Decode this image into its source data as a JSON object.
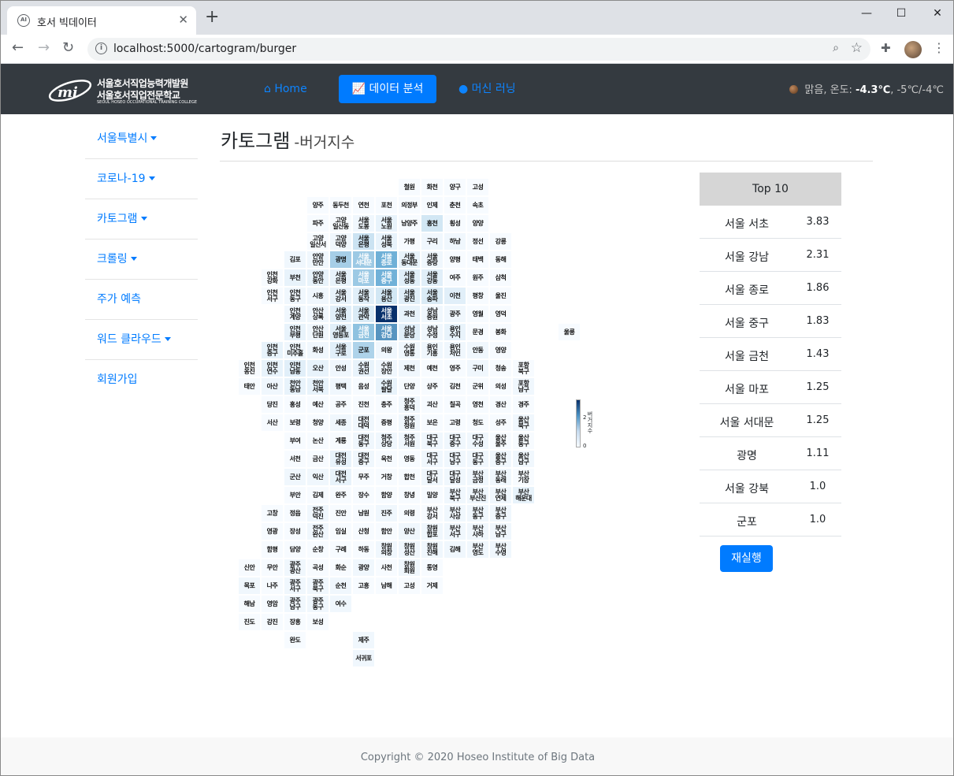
{
  "browser": {
    "tab_title": "호서 빅데이터",
    "url": "localhost:5000/cartogram/burger"
  },
  "site": {
    "logo_line1": "서울호서직업능력개발원",
    "logo_line2": "서울호서직업전문학교",
    "logo_line3": "SEOUL HOSEO OCCUPATIONAL TRAINING COLLEGE",
    "nav": {
      "home": "Home",
      "data": "데이터 분석",
      "ml": "머신 러닝"
    },
    "weather": {
      "prefix": "맑음, 온도: ",
      "temp": "-4.3℃",
      "range": ", -5℃/-4℃"
    }
  },
  "sidebar": [
    "서울특별시",
    "코로나-19",
    "카토그램",
    "크롤링",
    "주가 예측",
    "워드 클라우드",
    "회원가입"
  ],
  "heading": {
    "title": "카토그램",
    "subtitle": "-버거지수"
  },
  "chart_data": {
    "type": "heatmap",
    "title": "카토그램 -버거지수",
    "colorbar": {
      "label": "버거지수",
      "ticks": [
        "2",
        "0"
      ]
    },
    "colors": {
      "low": "#f7fbff",
      "high": "#08306b"
    },
    "cells": [
      [
        "철원",
        7,
        0,
        0
      ],
      [
        "화천",
        8,
        0,
        0
      ],
      [
        "양구",
        9,
        0,
        0
      ],
      [
        "고성",
        10,
        0,
        0
      ],
      [
        "양주",
        3,
        1,
        0
      ],
      [
        "동두천",
        4,
        1,
        0
      ],
      [
        "연천",
        5,
        1,
        0
      ],
      [
        "포천",
        6,
        1,
        0
      ],
      [
        "의정부",
        7,
        1,
        0
      ],
      [
        "인제",
        8,
        1,
        0
      ],
      [
        "춘천",
        9,
        1,
        0
      ],
      [
        "속초",
        10,
        1,
        0
      ],
      [
        "파주",
        3,
        2,
        0
      ],
      [
        "고양\n일산동",
        4,
        2,
        0
      ],
      [
        "서울\n도봉",
        5,
        2,
        0.1
      ],
      [
        "서울\n노원",
        6,
        2,
        0.2
      ],
      [
        "남양주",
        7,
        2,
        0
      ],
      [
        "홍천",
        8,
        2,
        0.5
      ],
      [
        "횡성",
        9,
        2,
        0
      ],
      [
        "양양",
        10,
        2,
        0
      ],
      [
        "고양\n일산서",
        3,
        3,
        0
      ],
      [
        "고양\n덕양",
        4,
        3,
        0.1
      ],
      [
        "서울\n은평",
        5,
        3,
        0.6
      ],
      [
        "서울\n성북",
        6,
        3,
        0.2
      ],
      [
        "가평",
        7,
        3,
        0
      ],
      [
        "구리",
        8,
        3,
        0.1
      ],
      [
        "하남",
        9,
        3,
        0.1
      ],
      [
        "정선",
        10,
        3,
        0
      ],
      [
        "강릉",
        11,
        3,
        0
      ],
      [
        "김포",
        2,
        4,
        0.1
      ],
      [
        "안양\n만안",
        3,
        4,
        0.1
      ],
      [
        "광명",
        4,
        4,
        1.11
      ],
      [
        "서울\n서대문",
        5,
        4,
        1.25
      ],
      [
        "서울\n종로",
        6,
        4,
        1.86
      ],
      [
        "서울\n동대문",
        7,
        4,
        0.2
      ],
      [
        "서울\n중랑",
        8,
        4,
        0.1
      ],
      [
        "양평",
        9,
        4,
        0
      ],
      [
        "태백",
        10,
        4,
        0
      ],
      [
        "동해",
        11,
        4,
        0
      ],
      [
        "인천\n강화",
        1,
        5,
        0
      ],
      [
        "부천",
        2,
        5,
        0.2
      ],
      [
        "안양\n동안",
        3,
        5,
        0.2
      ],
      [
        "서울\n은평",
        4,
        5,
        0.2
      ],
      [
        "서울\n마포",
        5,
        5,
        1.25
      ],
      [
        "서울\n중구",
        6,
        5,
        1.83
      ],
      [
        "서울\n성동",
        7,
        5,
        0.3
      ],
      [
        "서울\n강동",
        8,
        5,
        0.3
      ],
      [
        "여주",
        9,
        5,
        0
      ],
      [
        "원주",
        10,
        5,
        0
      ],
      [
        "삼척",
        11,
        5,
        0
      ],
      [
        "인천\n서구",
        1,
        6,
        0
      ],
      [
        "인천\n동구",
        2,
        6,
        0.1
      ],
      [
        "시흥",
        3,
        6,
        0.1
      ],
      [
        "서울\n강서",
        4,
        6,
        0.2
      ],
      [
        "서울\n동작",
        5,
        6,
        0.3
      ],
      [
        "서울\n용산",
        6,
        6,
        0.5
      ],
      [
        "서울\n광진",
        7,
        6,
        0.3
      ],
      [
        "서울\n송파",
        8,
        6,
        0.4
      ],
      [
        "이천",
        9,
        6,
        0.3
      ],
      [
        "평창",
        10,
        6,
        0
      ],
      [
        "울진",
        11,
        6,
        0
      ],
      [
        "인천\n계양",
        2,
        7,
        0.1
      ],
      [
        "안산\n상록",
        3,
        7,
        0.1
      ],
      [
        "서울\n양천",
        4,
        7,
        0.3
      ],
      [
        "서울\n관악",
        5,
        7,
        0.4
      ],
      [
        "서울\n서초",
        6,
        7,
        3.83
      ],
      [
        "과천",
        7,
        7,
        0.2
      ],
      [
        "성남\n중원",
        8,
        7,
        0.1
      ],
      [
        "광주",
        9,
        7,
        0.1
      ],
      [
        "영월",
        10,
        7,
        0
      ],
      [
        "영덕",
        11,
        7,
        0
      ],
      [
        "인천\n부평",
        2,
        8,
        0.2
      ],
      [
        "안산\n단원",
        3,
        8,
        0.1
      ],
      [
        "서울\n영등포",
        4,
        8,
        0.3
      ],
      [
        "서울\n금천",
        5,
        8,
        1.43
      ],
      [
        "서울\n강남",
        6,
        8,
        2.31
      ],
      [
        "성남\n분당",
        7,
        8,
        0.3
      ],
      [
        "성남\n수정",
        8,
        8,
        0.1
      ],
      [
        "용인\n수지",
        9,
        8,
        0.2
      ],
      [
        "문경",
        10,
        8,
        0
      ],
      [
        "봉화",
        11,
        8,
        0
      ],
      [
        "울릉",
        14,
        8,
        0
      ],
      [
        "인천\n중구",
        1,
        9,
        0.2
      ],
      [
        "인천\n미추홀",
        2,
        9,
        0.1
      ],
      [
        "화성",
        3,
        9,
        0.1
      ],
      [
        "서울\n구로",
        4,
        9,
        0.3
      ],
      [
        "군포",
        5,
        9,
        1.0
      ],
      [
        "의왕",
        6,
        9,
        0.1
      ],
      [
        "수원\n영통",
        7,
        9,
        0.1
      ],
      [
        "용인\n기흥",
        8,
        9,
        0.1
      ],
      [
        "용인\n처인",
        9,
        9,
        0.1
      ],
      [
        "안동",
        10,
        9,
        0.1
      ],
      [
        "영양",
        11,
        9,
        0
      ],
      [
        "인천\n옹진",
        0,
        10,
        0
      ],
      [
        "인천\n연수",
        1,
        10,
        0.2
      ],
      [
        "인천\n남동",
        2,
        10,
        0.3
      ],
      [
        "오산",
        3,
        10,
        0.2
      ],
      [
        "안성",
        4,
        10,
        0.1
      ],
      [
        "수원\n권선",
        5,
        10,
        0.2
      ],
      [
        "수원\n장안",
        6,
        10,
        0.1
      ],
      [
        "제천",
        7,
        10,
        0.1
      ],
      [
        "예천",
        8,
        10,
        0
      ],
      [
        "영주",
        9,
        10,
        0
      ],
      [
        "구미",
        10,
        10,
        0.1
      ],
      [
        "청송",
        11,
        10,
        0
      ],
      [
        "포항\n북구",
        12,
        10,
        0
      ],
      [
        "태안",
        0,
        11,
        0
      ],
      [
        "아산",
        1,
        11,
        0.1
      ],
      [
        "천안\n동남",
        2,
        11,
        0.2
      ],
      [
        "천안\n서북",
        3,
        11,
        0.2
      ],
      [
        "평택",
        4,
        11,
        0.1
      ],
      [
        "음성",
        5,
        11,
        0
      ],
      [
        "수원\n팔달",
        6,
        11,
        0.2
      ],
      [
        "단양",
        7,
        11,
        0
      ],
      [
        "상주",
        8,
        11,
        0
      ],
      [
        "김천",
        9,
        11,
        0
      ],
      [
        "군위",
        10,
        11,
        0
      ],
      [
        "의성",
        11,
        11,
        0
      ],
      [
        "포항\n남구",
        12,
        11,
        0.1
      ],
      [
        "당진",
        1,
        12,
        0
      ],
      [
        "홍성",
        2,
        12,
        0
      ],
      [
        "예산",
        3,
        12,
        0
      ],
      [
        "공주",
        4,
        12,
        0
      ],
      [
        "진천",
        5,
        12,
        0
      ],
      [
        "충주",
        6,
        12,
        0
      ],
      [
        "청주\n흥덕",
        7,
        12,
        0.1
      ],
      [
        "괴산",
        8,
        12,
        0
      ],
      [
        "칠곡",
        9,
        12,
        0
      ],
      [
        "영천",
        10,
        12,
        0
      ],
      [
        "경산",
        11,
        12,
        0
      ],
      [
        "경주",
        12,
        12,
        0
      ],
      [
        "서산",
        1,
        13,
        0
      ],
      [
        "보령",
        2,
        13,
        0
      ],
      [
        "청양",
        3,
        13,
        0
      ],
      [
        "세종",
        4,
        13,
        0.1
      ],
      [
        "대전\n대덕",
        5,
        13,
        0.1
      ],
      [
        "증평",
        6,
        13,
        0
      ],
      [
        "청주\n청원",
        7,
        13,
        0.1
      ],
      [
        "보은",
        8,
        13,
        0
      ],
      [
        "고령",
        9,
        13,
        0
      ],
      [
        "청도",
        10,
        13,
        0
      ],
      [
        "성주",
        11,
        13,
        0
      ],
      [
        "울산\n북구",
        12,
        13,
        0.1
      ],
      [
        "부여",
        2,
        14,
        0
      ],
      [
        "논산",
        3,
        14,
        0
      ],
      [
        "계룡",
        4,
        14,
        0
      ],
      [
        "대전\n동구",
        5,
        14,
        0.1
      ],
      [
        "청주\n상당",
        6,
        14,
        0.1
      ],
      [
        "청주\n서원",
        7,
        14,
        0.1
      ],
      [
        "대구\n북구",
        8,
        14,
        0.1
      ],
      [
        "대구\n중구",
        9,
        14,
        0.1
      ],
      [
        "대구\n수성",
        10,
        14,
        0.1
      ],
      [
        "울산\n울주",
        11,
        14,
        0
      ],
      [
        "울산\n동구",
        12,
        14,
        0
      ],
      [
        "서천",
        2,
        15,
        0
      ],
      [
        "금산",
        3,
        15,
        0
      ],
      [
        "대전\n유성",
        4,
        15,
        0.2
      ],
      [
        "대전\n중구",
        5,
        15,
        0.1
      ],
      [
        "옥천",
        6,
        15,
        0
      ],
      [
        "영동",
        7,
        15,
        0
      ],
      [
        "대구\n서구",
        8,
        15,
        0.1
      ],
      [
        "대구\n남구",
        9,
        15,
        0.1
      ],
      [
        "대구\n동구",
        10,
        15,
        0.1
      ],
      [
        "울산\n중구",
        11,
        15,
        0.1
      ],
      [
        "울산\n남구",
        12,
        15,
        0.1
      ],
      [
        "군산",
        2,
        16,
        0.1
      ],
      [
        "익산",
        3,
        16,
        0.1
      ],
      [
        "대전\n서구",
        4,
        16,
        0.2
      ],
      [
        "무주",
        5,
        16,
        0
      ],
      [
        "거창",
        6,
        16,
        0
      ],
      [
        "합천",
        7,
        16,
        0
      ],
      [
        "대구\n달서",
        8,
        16,
        0.1
      ],
      [
        "대구\n달성",
        9,
        16,
        0.1
      ],
      [
        "부산\n금정",
        10,
        16,
        0.1
      ],
      [
        "부산\n동래",
        11,
        16,
        0.1
      ],
      [
        "부산\n기장",
        12,
        16,
        0
      ],
      [
        "부안",
        2,
        17,
        0
      ],
      [
        "김제",
        3,
        17,
        0
      ],
      [
        "완주",
        4,
        17,
        0
      ],
      [
        "장수",
        5,
        17,
        0
      ],
      [
        "함양",
        6,
        17,
        0
      ],
      [
        "창녕",
        7,
        17,
        0
      ],
      [
        "밀양",
        8,
        17,
        0
      ],
      [
        "부산\n북구",
        9,
        17,
        0.1
      ],
      [
        "부산\n부산진",
        10,
        17,
        0.1
      ],
      [
        "부산\n연제",
        11,
        17,
        0.1
      ],
      [
        "부산\n해운대",
        12,
        17,
        0.2
      ],
      [
        "고창",
        1,
        18,
        0
      ],
      [
        "정읍",
        2,
        18,
        0
      ],
      [
        "전주\n덕진",
        3,
        18,
        0.1
      ],
      [
        "진안",
        4,
        18,
        0
      ],
      [
        "남원",
        5,
        18,
        0
      ],
      [
        "진주",
        6,
        18,
        0.1
      ],
      [
        "의령",
        7,
        18,
        0
      ],
      [
        "부산\n강서",
        8,
        18,
        0
      ],
      [
        "부산\n사상",
        9,
        18,
        0.1
      ],
      [
        "부산\n동구",
        10,
        18,
        0.1
      ],
      [
        "부산\n중구",
        11,
        18,
        0.1
      ],
      [
        "영광",
        1,
        19,
        0
      ],
      [
        "장성",
        2,
        19,
        0
      ],
      [
        "전주\n완산",
        3,
        19,
        0.1
      ],
      [
        "임실",
        4,
        19,
        0
      ],
      [
        "산청",
        5,
        19,
        0
      ],
      [
        "함안",
        6,
        19,
        0
      ],
      [
        "양산",
        7,
        19,
        0.1
      ],
      [
        "창원\n합포",
        8,
        19,
        0.1
      ],
      [
        "부산\n서구",
        9,
        19,
        0.1
      ],
      [
        "부산\n사하",
        10,
        19,
        0.1
      ],
      [
        "부산\n남구",
        11,
        19,
        0.1
      ],
      [
        "함평",
        1,
        20,
        0
      ],
      [
        "담양",
        2,
        20,
        0
      ],
      [
        "순창",
        3,
        20,
        0
      ],
      [
        "구례",
        4,
        20,
        0
      ],
      [
        "하동",
        5,
        20,
        0
      ],
      [
        "창원\n의창",
        6,
        20,
        0.1
      ],
      [
        "창원\n성산",
        7,
        20,
        0.1
      ],
      [
        "창원\n진해",
        8,
        20,
        0.1
      ],
      [
        "김해",
        9,
        20,
        0.1
      ],
      [
        "부산\n영도",
        10,
        20,
        0.1
      ],
      [
        "부산\n수영",
        11,
        20,
        0.1
      ],
      [
        "신안",
        0,
        21,
        0
      ],
      [
        "무안",
        1,
        21,
        0
      ],
      [
        "광주\n광산",
        2,
        21,
        0.1
      ],
      [
        "곡성",
        3,
        21,
        0
      ],
      [
        "화순",
        4,
        21,
        0
      ],
      [
        "광양",
        5,
        21,
        0.1
      ],
      [
        "사천",
        6,
        21,
        0
      ],
      [
        "창원\n회원",
        7,
        21,
        0.1
      ],
      [
        "통영",
        8,
        21,
        0
      ],
      [
        "목포",
        0,
        22,
        0.1
      ],
      [
        "나주",
        1,
        22,
        0
      ],
      [
        "광주\n서구",
        2,
        22,
        0.1
      ],
      [
        "광주\n북구",
        3,
        22,
        0.1
      ],
      [
        "순천",
        4,
        22,
        0.1
      ],
      [
        "고흥",
        5,
        22,
        0
      ],
      [
        "남해",
        6,
        22,
        0
      ],
      [
        "고성",
        7,
        22,
        0
      ],
      [
        "거제",
        8,
        22,
        0
      ],
      [
        "해남",
        0,
        23,
        0
      ],
      [
        "영암",
        1,
        23,
        0
      ],
      [
        "광주\n남구",
        2,
        23,
        0.1
      ],
      [
        "광주\n동구",
        3,
        23,
        0.1
      ],
      [
        "여수",
        4,
        23,
        0.1
      ],
      [
        "진도",
        0,
        24,
        0
      ],
      [
        "강진",
        1,
        24,
        0
      ],
      [
        "장흥",
        2,
        24,
        0
      ],
      [
        "보성",
        3,
        24,
        0
      ],
      [
        "완도",
        2,
        25,
        0
      ],
      [
        "제주",
        5,
        25,
        0.1
      ],
      [
        "서귀포",
        5,
        26,
        0.1
      ]
    ]
  },
  "top10": {
    "header": "Top 10",
    "rows": [
      {
        "name": "서울 서초",
        "value": "3.83"
      },
      {
        "name": "서울 강남",
        "value": "2.31"
      },
      {
        "name": "서울 종로",
        "value": "1.86"
      },
      {
        "name": "서울 중구",
        "value": "1.83"
      },
      {
        "name": "서울 금천",
        "value": "1.43"
      },
      {
        "name": "서울 마포",
        "value": "1.25"
      },
      {
        "name": "서울 서대문",
        "value": "1.25"
      },
      {
        "name": "광명",
        "value": "1.11"
      },
      {
        "name": "서울 강북",
        "value": "1.0"
      },
      {
        "name": "군포",
        "value": "1.0"
      }
    ],
    "rerun": "재실행"
  },
  "footer": "Copyright © 2020 Hoseo Institute of Big Data"
}
